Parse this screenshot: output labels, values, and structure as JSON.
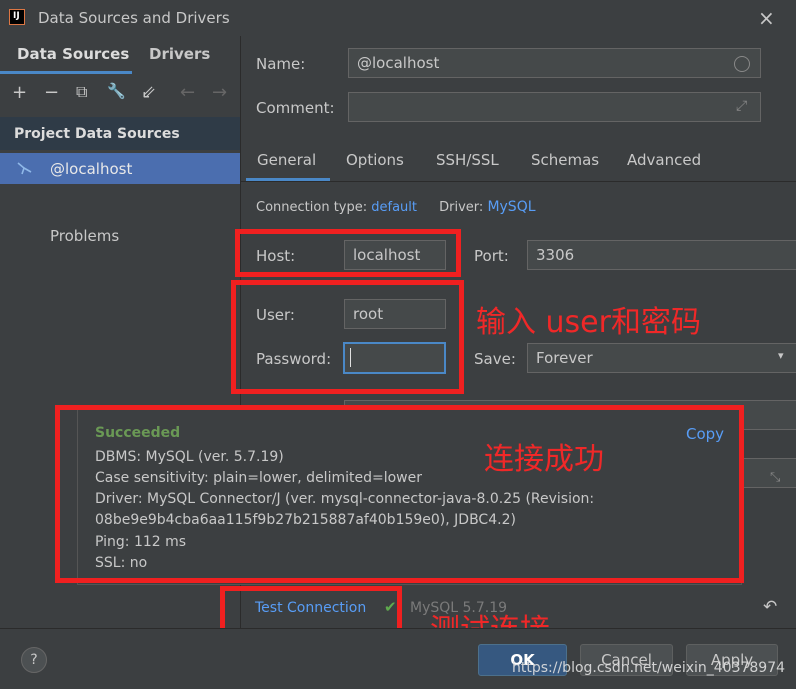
{
  "window": {
    "title": "Data Sources and Drivers",
    "close_icon": "×"
  },
  "left_tabs": {
    "data_sources": "Data Sources",
    "drivers": "Drivers"
  },
  "toolbar": {
    "add": "+",
    "remove": "−",
    "copy": "⧉",
    "settings": "🔧",
    "import": "⇙",
    "back": "←",
    "forward": "→"
  },
  "sidebar": {
    "section_title": "Project Data Sources",
    "selected_item": "@localhost",
    "problems": "Problems"
  },
  "form": {
    "name_label": "Name:",
    "name_value": "@localhost",
    "comment_label": "Comment:",
    "comment_value": "",
    "tabs": [
      "General",
      "Options",
      "SSH/SSL",
      "Schemas",
      "Advanced"
    ],
    "connection_type_label": "Connection type:",
    "connection_type_value": "default",
    "driver_label": "Driver:",
    "driver_value": "MySQL",
    "host_label": "Host:",
    "host_value": "localhost",
    "port_label": "Port:",
    "port_value": "3306",
    "user_label": "User:",
    "user_value": "root",
    "password_label": "Password:",
    "password_value": "",
    "save_label": "Save:",
    "save_value": "Forever"
  },
  "annotations": {
    "input_note": "输入 user和密码",
    "success_note": "连接成功",
    "test_note": "测试连接"
  },
  "popup": {
    "status": "Succeeded",
    "copy": "Copy",
    "lines": [
      "DBMS: MySQL (ver. 5.7.19)",
      "Case sensitivity: plain=lower, delimited=lower",
      "Driver: MySQL Connector/J (ver. mysql-connector-java-8.0.25 (Revision:",
      "08be9e9b4cba6aa115f9b27b215887af40b159e0), JDBC4.2)",
      "Ping: 112 ms",
      "SSL: no"
    ]
  },
  "test_connection": {
    "label": "Test Connection",
    "check": "✔",
    "version": "MySQL 5.7.19"
  },
  "buttons": {
    "help": "?",
    "ok": "OK",
    "cancel": "Cancel",
    "apply": "Apply",
    "revert_icon": "↶"
  },
  "watermark": "https://blog.csdn.net/weixin_40378974",
  "colors": {
    "accent": "#4a88c7",
    "link": "#589df6",
    "success": "#6a9955",
    "annotation": "#f02020"
  }
}
